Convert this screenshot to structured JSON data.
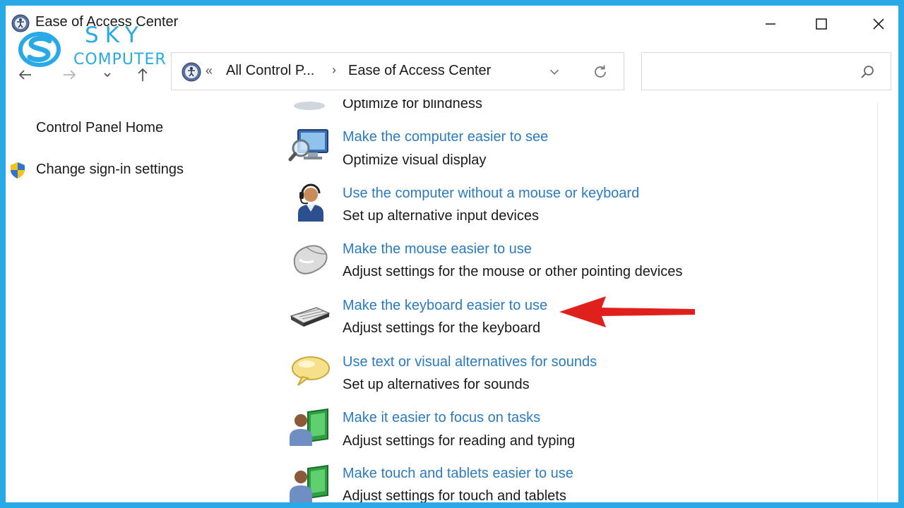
{
  "window": {
    "title": "Ease of Access Center",
    "controls": [
      "minimize",
      "maximize",
      "close"
    ]
  },
  "watermark": {
    "line1": "SKY",
    "line2": "COMPUTER",
    "color": "#29a9e6"
  },
  "address_bar": {
    "overflow_marker": "«",
    "crumbs": [
      "All Control P...",
      "Ease of Access Center"
    ],
    "separator": "›"
  },
  "search": {
    "placeholder": ""
  },
  "left_pane": {
    "home_link": "Control Panel Home",
    "signin_link": "Change sign-in settings"
  },
  "partial_top_item": {
    "desc": "Optimize for blindness"
  },
  "items": [
    {
      "icon": "monitor-magnifier-icon",
      "link": "Make the computer easier to see",
      "desc": "Optimize visual display"
    },
    {
      "icon": "headset-person-icon",
      "link": "Use the computer without a mouse or keyboard",
      "desc": "Set up alternative input devices"
    },
    {
      "icon": "mouse-icon",
      "link": "Make the mouse easier to use",
      "desc": "Adjust settings for the mouse or other pointing devices"
    },
    {
      "icon": "keyboard-icon",
      "link": "Make the keyboard easier to use",
      "desc": "Adjust settings for the keyboard"
    },
    {
      "icon": "speech-bubble-icon",
      "link": "Use text or visual alternatives for sounds",
      "desc": "Set up alternatives for sounds"
    },
    {
      "icon": "person-green-panel-icon",
      "link": "Make it easier to focus on tasks",
      "desc": "Adjust settings for reading and typing"
    },
    {
      "icon": "person-green-panel-icon",
      "link": "Make touch and tablets easier to use",
      "desc": "Adjust settings for touch and tablets"
    }
  ],
  "colors": {
    "frame": "#29a9e6",
    "link": "#2b7bbf",
    "annotation_arrow": "#e0201c"
  }
}
